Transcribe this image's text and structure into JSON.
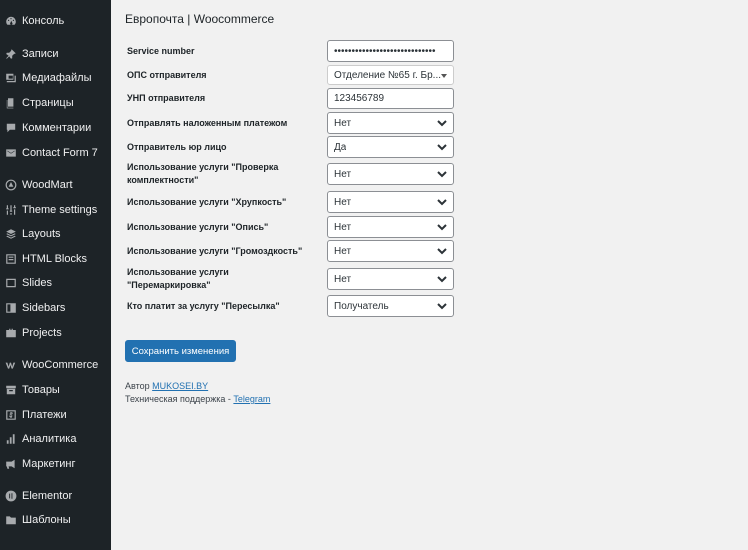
{
  "sidebar": {
    "items": [
      {
        "label": "Консоль",
        "icon": "dashboard-icon"
      },
      {
        "label": "Записи",
        "icon": "pin-icon"
      },
      {
        "label": "Медиафайлы",
        "icon": "media-icon"
      },
      {
        "label": "Страницы",
        "icon": "pages-icon"
      },
      {
        "label": "Комментарии",
        "icon": "comments-icon"
      },
      {
        "label": "Contact Form 7",
        "icon": "mail-icon"
      },
      {
        "label": "WoodMart",
        "icon": "woodmart-icon"
      },
      {
        "label": "Theme settings",
        "icon": "sliders-icon"
      },
      {
        "label": "Layouts",
        "icon": "layers-icon"
      },
      {
        "label": "HTML Blocks",
        "icon": "blocks-icon"
      },
      {
        "label": "Slides",
        "icon": "slides-icon"
      },
      {
        "label": "Sidebars",
        "icon": "sidebars-icon"
      },
      {
        "label": "Projects",
        "icon": "briefcase-icon"
      },
      {
        "label": "WooCommerce",
        "icon": "woocommerce-icon"
      },
      {
        "label": "Товары",
        "icon": "archive-icon"
      },
      {
        "label": "Платежи",
        "icon": "dollar-icon"
      },
      {
        "label": "Аналитика",
        "icon": "chart-icon"
      },
      {
        "label": "Маркетинг",
        "icon": "megaphone-icon"
      },
      {
        "label": "Elementor",
        "icon": "elementor-icon"
      },
      {
        "label": "Шаблоны",
        "icon": "folder-icon"
      }
    ]
  },
  "main": {
    "title": "Европочта | Woocommerce",
    "fields": [
      {
        "label": "Service number",
        "value": "•••••••••••••••••••••••••••••",
        "kind": "password"
      },
      {
        "label": "ОПС отправителя",
        "value": "Отделение №65 г. Бр...",
        "kind": "select2"
      },
      {
        "label": "УНП отправителя",
        "value": "123456789",
        "kind": "text"
      },
      {
        "label": "Отправлять наложенным платежом",
        "value": "Нет",
        "kind": "select"
      },
      {
        "label": "Отправитель юр лицо",
        "value": "Да",
        "kind": "select"
      },
      {
        "label": "Использование услуги \"Проверка комплектности\"",
        "value": "Нет",
        "kind": "select"
      },
      {
        "label": "Использование услуги \"Хрупкость\"",
        "value": "Нет",
        "kind": "select"
      },
      {
        "label": "Использование услуги \"Опись\"",
        "value": "Нет",
        "kind": "select"
      },
      {
        "label": "Использование услуги \"Громоздкость\"",
        "value": "Нет",
        "kind": "select"
      },
      {
        "label": "Использование услуги \"Перемаркировка\"",
        "value": "Нет",
        "kind": "select"
      },
      {
        "label": "Кто платит за услугу \"Пересылка\"",
        "value": "Получатель",
        "kind": "select"
      }
    ],
    "save_label": "Сохранить изменения",
    "footer": {
      "author_prefix": "Автор",
      "author_link": "MUKOSEI.BY",
      "support_prefix": "Техническая поддержка -",
      "support_link": "Telegram"
    }
  }
}
